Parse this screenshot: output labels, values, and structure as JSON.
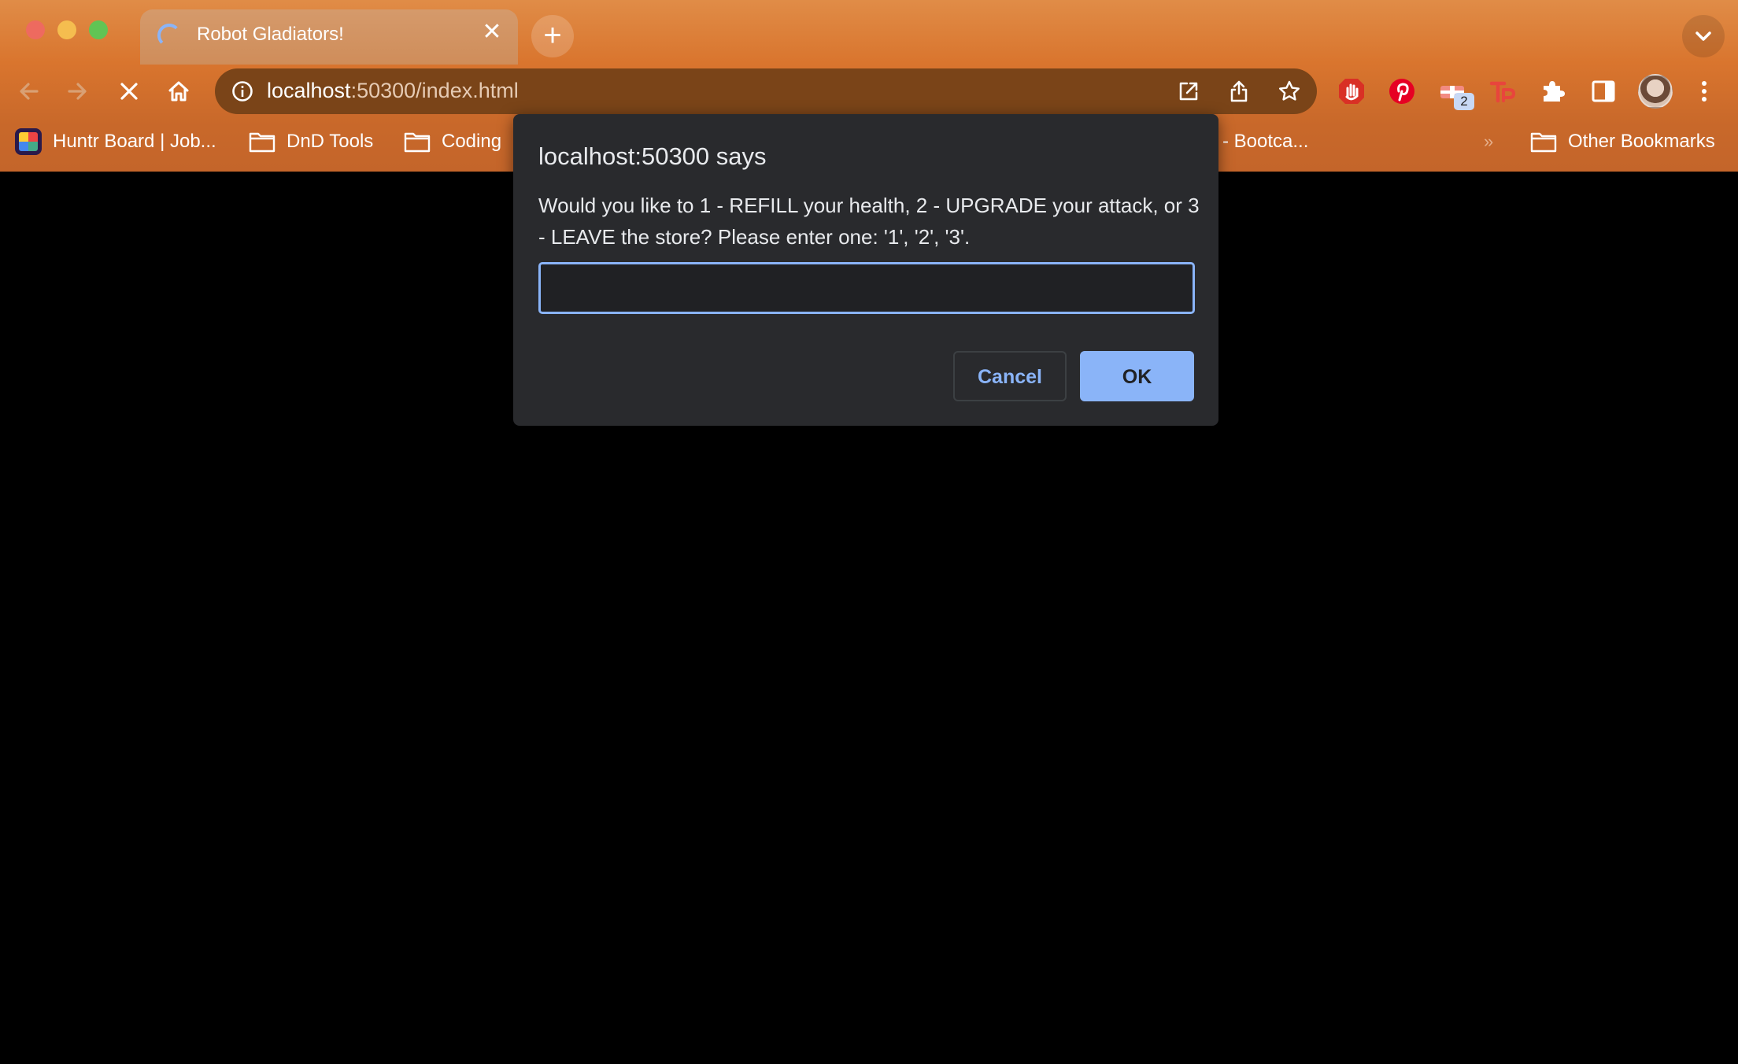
{
  "browser": {
    "tab": {
      "title": "Robot Gladiators!",
      "close_glyph": "✕"
    },
    "new_tab_glyph": "+",
    "url": {
      "host": "localhost",
      "rest": ":50300/index.html"
    },
    "extension_badge": "2",
    "bookmarks": [
      {
        "label": "Huntr Board | Job..."
      },
      {
        "label": "DnD Tools"
      },
      {
        "label": "Coding"
      },
      {
        "label": "- Bootca..."
      },
      {
        "label": "Other Bookmarks"
      }
    ],
    "bookmarks_overflow": "»"
  },
  "dialog": {
    "title": "localhost:50300 says",
    "message": "Would you like to 1 - REFILL your health, 2 - UPGRADE your attack, or 3 - LEAVE the store? Please enter one: '1', '2', '3'.",
    "input_value": "",
    "cancel_label": "Cancel",
    "ok_label": "OK"
  },
  "colors": {
    "chrome_orange": "#d9752e",
    "omnibox": "#7a4418",
    "dialog_bg": "#292a2d",
    "accent_blue": "#8ab4f8"
  }
}
